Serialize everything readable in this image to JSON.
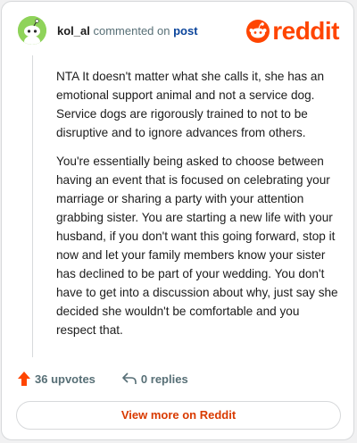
{
  "header": {
    "username": "kol_al",
    "action_text": "commented on",
    "post_link": "post",
    "logo_text": "reddit"
  },
  "comment": {
    "paragraphs": [
      "NTA It doesn't matter what she calls it, she has an emotional support animal and not a service dog. Service dogs are rigorously trained to not to be disruptive and to ignore advances from others.",
      "You're essentially being asked to choose between having an event that is focused on celebrating your marriage or sharing a party with your attention grabbing sister. You are starting a new life with your husband, if you don't want this going forward, stop it now and let your family members know your sister has declined to be part of your wedding. You don't have to get into a discussion about why, just say she decided she wouldn't be comfortable and you respect that."
    ]
  },
  "actions": {
    "upvotes": "36 upvotes",
    "replies": "0 replies"
  },
  "footer": {
    "view_more": "View more on Reddit"
  },
  "icons": {
    "avatar": "snoo-avatar-icon",
    "logo": "reddit-logo-icon",
    "upvote": "upvote-arrow-icon",
    "reply": "reply-arrow-icon"
  },
  "colors": {
    "brand": "#ff4500",
    "link": "#0a449b",
    "upvote": "#ff4500",
    "avatar_bg": "#8fd35a",
    "view_more_text": "#d93a00"
  }
}
